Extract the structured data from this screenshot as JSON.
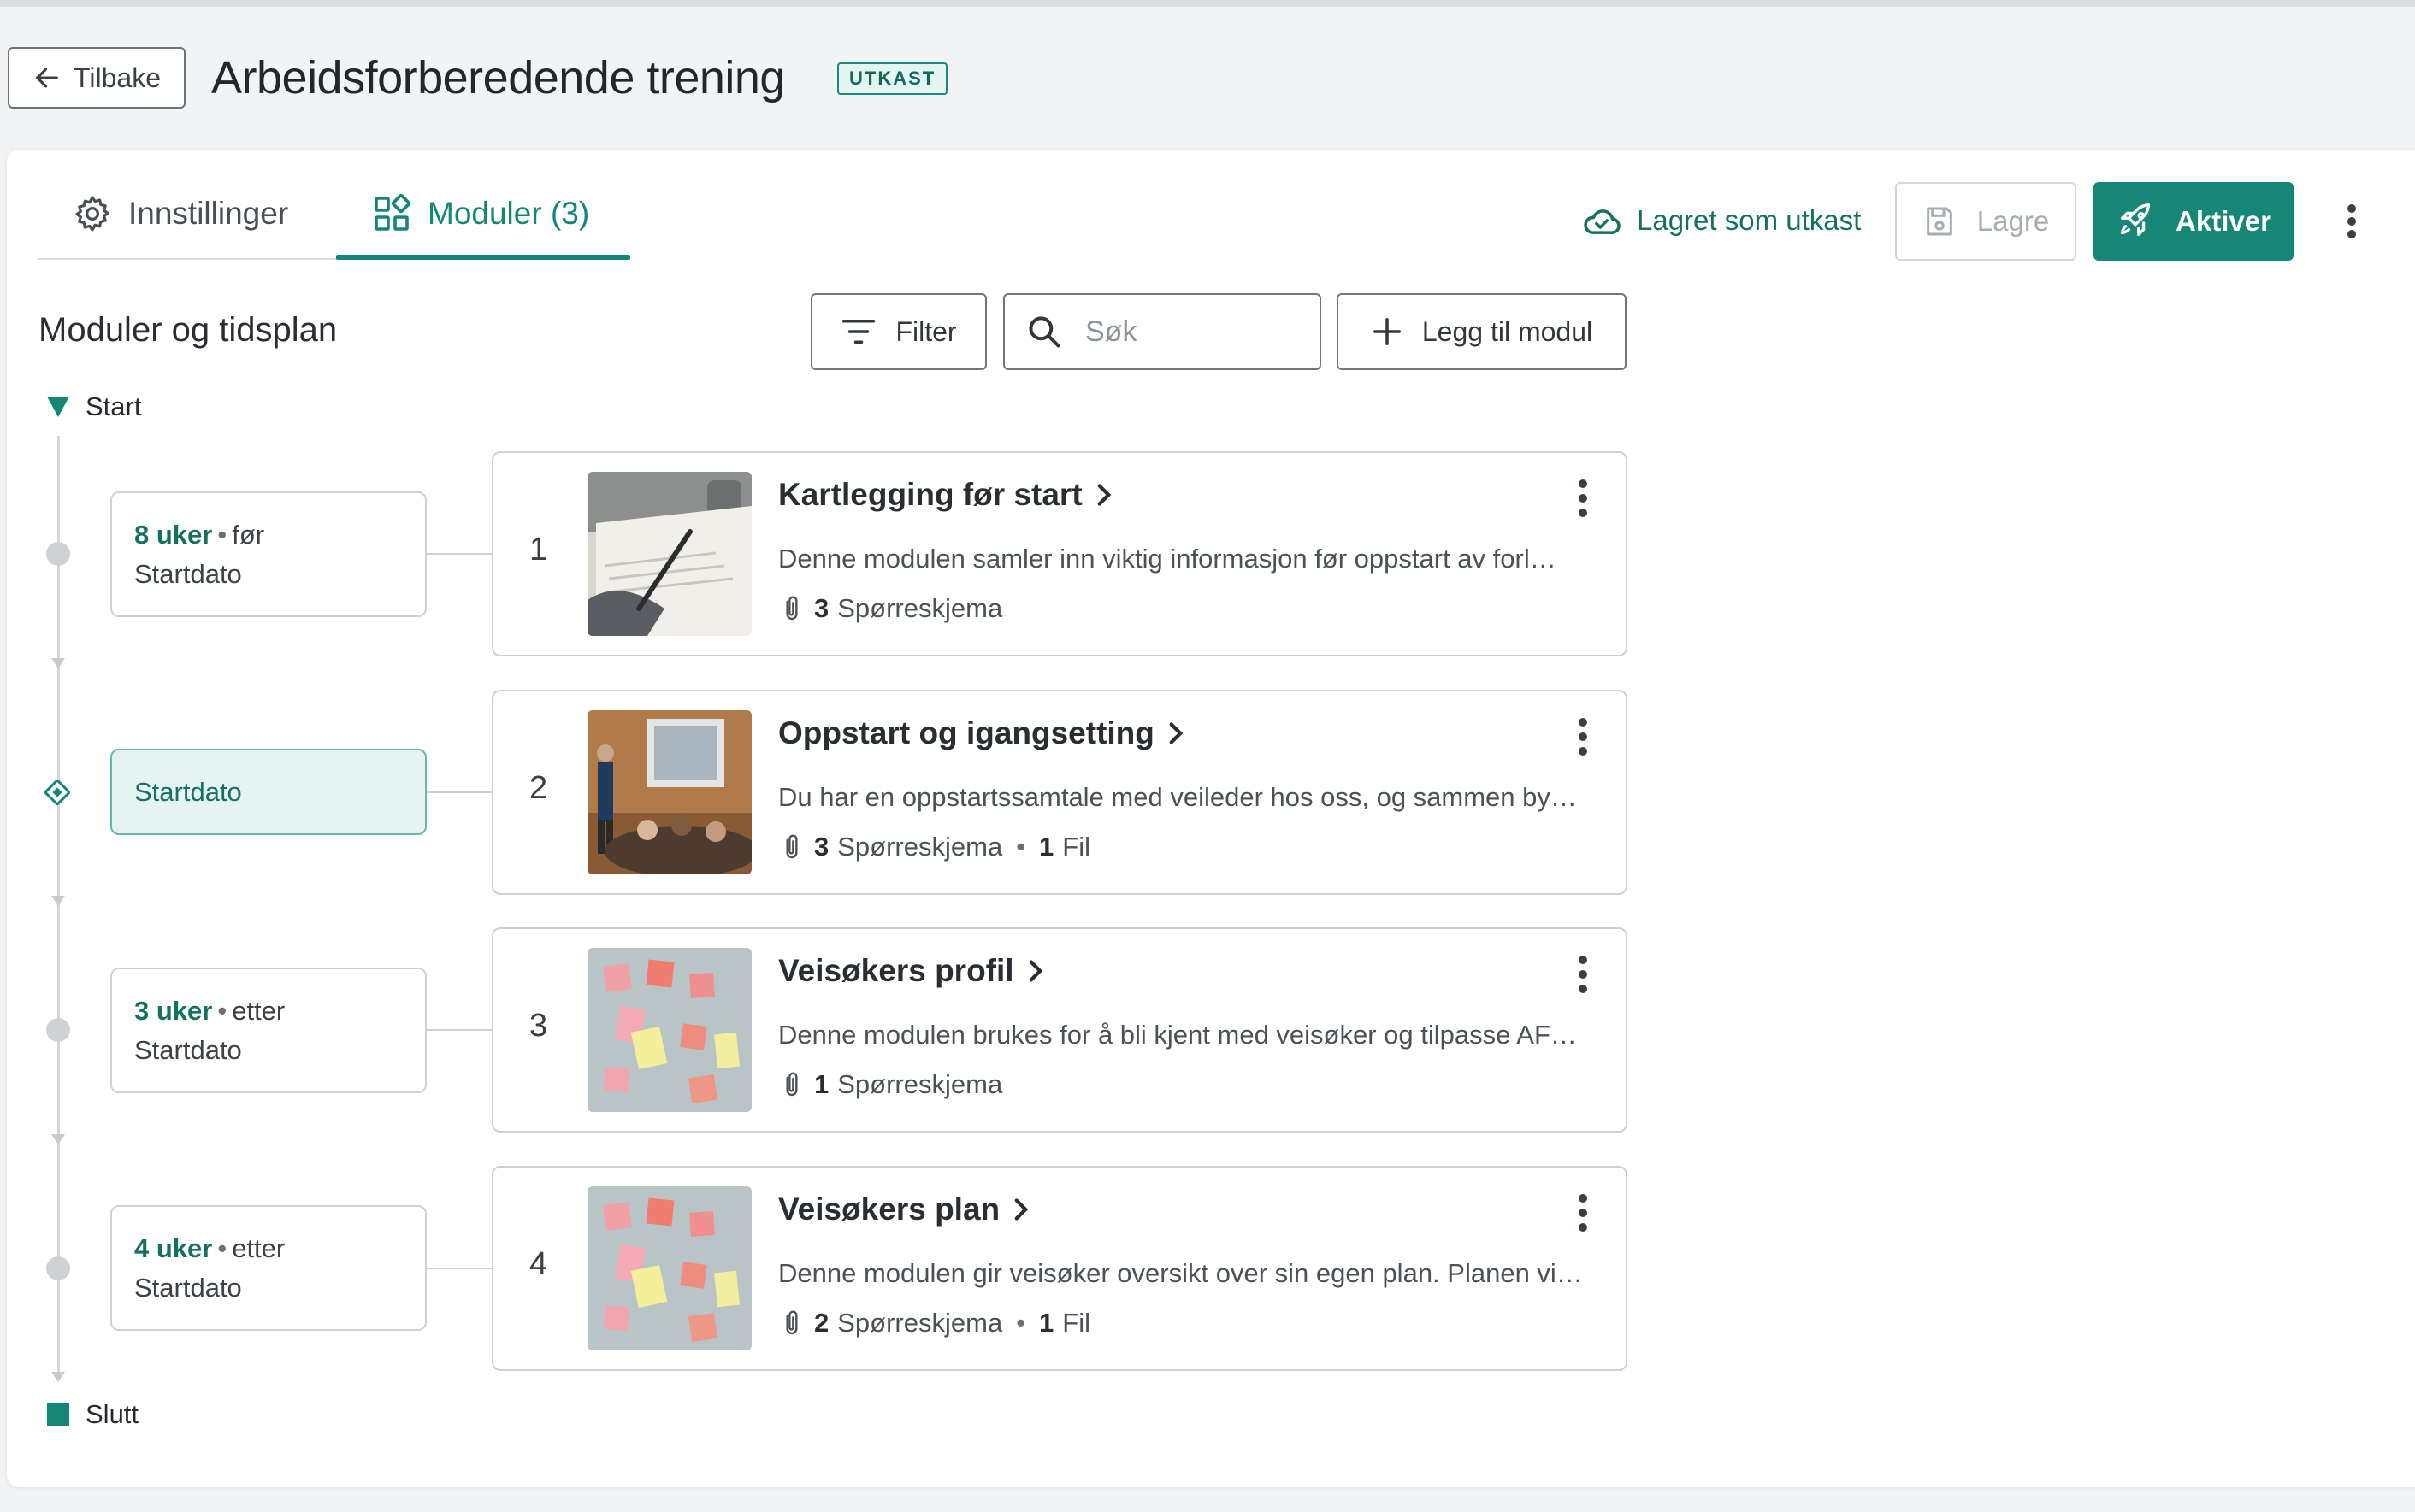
{
  "header": {
    "back_label": "Tilbake",
    "title": "Arbeidsforberedende trening",
    "badge": "UTKAST"
  },
  "tabs": [
    {
      "label": "Innstillinger",
      "icon": "gear-icon"
    },
    {
      "label": "Moduler (3)",
      "icon": "modules-grid-icon",
      "active": true
    }
  ],
  "toolbar": {
    "saved_status": "Lagret som utkast",
    "save_label": "Lagre",
    "activate_label": "Aktiver"
  },
  "section": {
    "title": "Moduler og tidsplan",
    "filter_label": "Filter",
    "search_placeholder": "Søk",
    "add_label": "Legg til modul"
  },
  "timeline": {
    "start_label": "Start",
    "end_label": "Slutt",
    "timings": [
      {
        "amount": "8 uker",
        "relation": "før",
        "anchor": "Startdato"
      },
      {
        "label": "Startdato"
      },
      {
        "amount": "3 uker",
        "relation": "etter",
        "anchor": "Startdato"
      },
      {
        "amount": "4 uker",
        "relation": "etter",
        "anchor": "Startdato"
      }
    ]
  },
  "modules": [
    {
      "number": "1",
      "title": "Kartlegging før start",
      "description": "Denne modulen samler inn viktig informasjon før oppstart av forl…",
      "questionnaires_count": "3",
      "questionnaires_label": "Spørreskjema",
      "files_count": "",
      "files_label": ""
    },
    {
      "number": "2",
      "title": "Oppstart og igangsetting",
      "description": "Du har en oppstartssamtale med veileder hos oss, og sammen by…",
      "questionnaires_count": "3",
      "questionnaires_label": "Spørreskjema",
      "files_count": "1",
      "files_label": "Fil"
    },
    {
      "number": "3",
      "title": "Veisøkers profil",
      "description": "Denne modulen brukes for å bli kjent med veisøker og tilpasse AF…",
      "questionnaires_count": "1",
      "questionnaires_label": "Spørreskjema",
      "files_count": "",
      "files_label": ""
    },
    {
      "number": "4",
      "title": "Veisøkers plan",
      "description": "Denne modulen gir veisøker oversikt over sin egen plan. Planen vi…",
      "questionnaires_count": "2",
      "questionnaires_label": "Spørreskjema",
      "files_count": "1",
      "files_label": "Fil"
    }
  ],
  "colors": {
    "accent": "#168676",
    "accent_dark": "#14705f",
    "accent_light": "#e6f4f1",
    "border": "#cdd1d4"
  }
}
